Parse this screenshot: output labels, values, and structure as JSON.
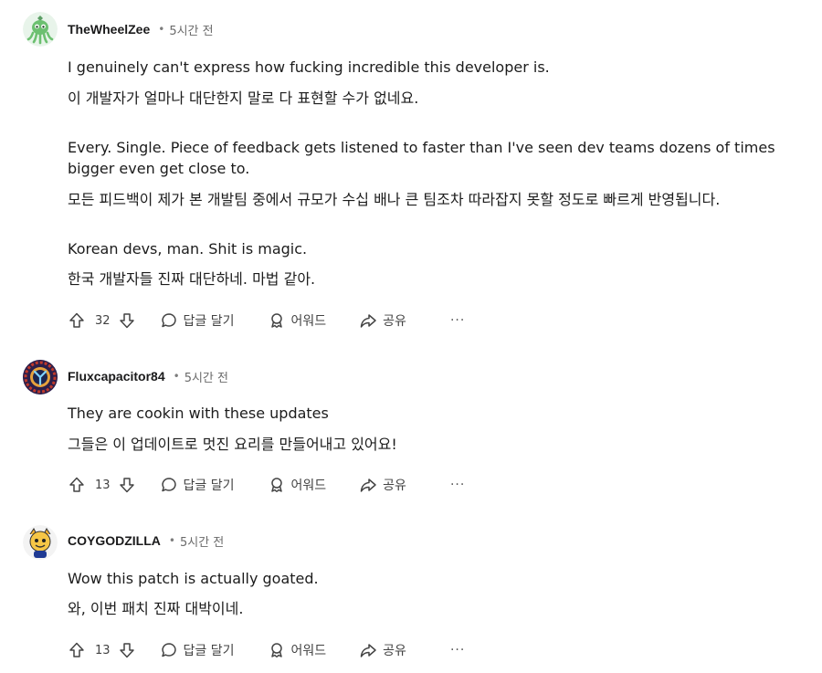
{
  "comments": [
    {
      "username": "TheWheelZee",
      "time": "5시간 전",
      "lines": [
        "I genuinely can't express how fucking incredible this developer is.",
        "이 개발자가 얼마나 대단한지 말로 다 표현할 수가 없네요.",
        "Every. Single. Piece of feedback gets listened to faster than I've seen dev teams dozens of times bigger even get close to.",
        "모든 피드백이 제가 본 개발팀 중에서 규모가 수십 배나 큰 팀조차 따라잡지 못할 정도로 빠르게 반영됩니다.",
        "Korean devs, man. Shit is magic.",
        "한국 개발자들 진짜 대단하네. 마법 같아."
      ],
      "votes": "32"
    },
    {
      "username": "Fluxcapacitor84",
      "time": "5시간 전",
      "lines": [
        "They are cookin with these updates",
        "그들은 이 업데이트로 멋진 요리를 만들어내고 있어요!"
      ],
      "votes": "13"
    },
    {
      "username": "COYGODZILLA",
      "time": "5시간 전",
      "lines": [
        "Wow this patch is actually goated.",
        "와, 이번 패치 진짜 대박이네."
      ],
      "votes": "13"
    }
  ],
  "actions": {
    "reply_label": "답글 달기",
    "award_label": "어워드",
    "share_label": "공유",
    "more_label": "···",
    "dot": "•"
  },
  "icons": {
    "upvote": "upvote-icon",
    "downvote": "downvote-icon",
    "reply": "comment-bubble-icon",
    "award": "award-icon",
    "share": "share-arrow-icon"
  }
}
